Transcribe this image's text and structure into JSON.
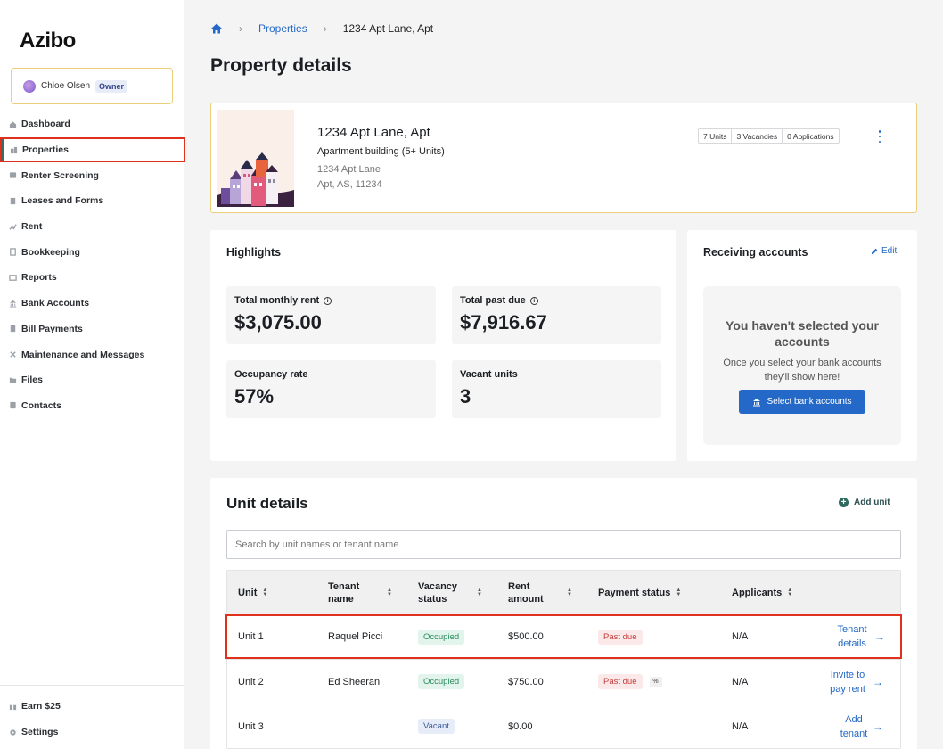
{
  "app": {
    "logo": "Azibo"
  },
  "user": {
    "name": "Chloe Olsen",
    "role": "Owner"
  },
  "sidebar": {
    "items": [
      {
        "label": "Dashboard",
        "icon": "home-icon"
      },
      {
        "label": "Properties",
        "icon": "buildings-icon",
        "active": true
      },
      {
        "label": "Renter Screening",
        "icon": "screening-icon"
      },
      {
        "label": "Leases and Forms",
        "icon": "document-icon"
      },
      {
        "label": "Rent",
        "icon": "rent-icon"
      },
      {
        "label": "Bookkeeping",
        "icon": "ledger-icon"
      },
      {
        "label": "Reports",
        "icon": "report-icon"
      },
      {
        "label": "Bank Accounts",
        "icon": "bank-icon"
      },
      {
        "label": "Bill Payments",
        "icon": "bill-icon"
      },
      {
        "label": "Maintenance and Messages",
        "icon": "tools-icon"
      },
      {
        "label": "Files",
        "icon": "folder-icon"
      },
      {
        "label": "Contacts",
        "icon": "contacts-icon"
      }
    ],
    "bottom": [
      {
        "label": "Earn $25",
        "icon": "gift-icon"
      },
      {
        "label": "Settings",
        "icon": "gear-icon"
      }
    ]
  },
  "breadcrumb": {
    "link": "Properties",
    "current": "1234 Apt Lane, Apt"
  },
  "page": {
    "title": "Property details"
  },
  "property": {
    "name": "1234 Apt Lane, Apt",
    "type": "Apartment building (5+ Units)",
    "address_line1": "1234 Apt Lane",
    "address_line2": "Apt, AS, 11234",
    "stats": {
      "units": "7 Units",
      "vacancies": "3 Vacancies",
      "applications": "0 Applications"
    }
  },
  "highlights": {
    "title": "Highlights",
    "total_monthly_rent": {
      "label": "Total monthly rent",
      "value": "$3,075.00"
    },
    "total_past_due": {
      "label": "Total past due",
      "value": "$7,916.67"
    },
    "occupancy_rate": {
      "label": "Occupancy rate",
      "value": "57%"
    },
    "vacant_units": {
      "label": "Vacant units",
      "value": "3"
    }
  },
  "receiving": {
    "title": "Receiving accounts",
    "edit": "Edit",
    "empty_title": "You haven't selected your accounts",
    "empty_desc": "Once you select your bank accounts they'll show here!",
    "button": "Select bank accounts"
  },
  "units": {
    "title": "Unit details",
    "add": "Add unit",
    "search_placeholder": "Search by unit names or tenant name",
    "columns": [
      "Unit",
      "Tenant name",
      "Vacancy status",
      "Rent amount",
      "Payment status",
      "Applicants"
    ],
    "rows": [
      {
        "unit": "Unit 1",
        "tenant": "Raquel Picci",
        "vacancy": "Occupied",
        "rent": "$500.00",
        "payment": "Past due",
        "applicants": "N/A",
        "action": "Tenant details"
      },
      {
        "unit": "Unit 2",
        "tenant": "Ed Sheeran",
        "vacancy": "Occupied",
        "rent": "$750.00",
        "payment": "Past due",
        "applicants": "N/A",
        "action": "Invite to pay rent"
      },
      {
        "unit": "Unit 3",
        "tenant": "",
        "vacancy": "Vacant",
        "rent": "$0.00",
        "payment": "",
        "applicants": "N/A",
        "action": "Add tenant"
      }
    ]
  }
}
